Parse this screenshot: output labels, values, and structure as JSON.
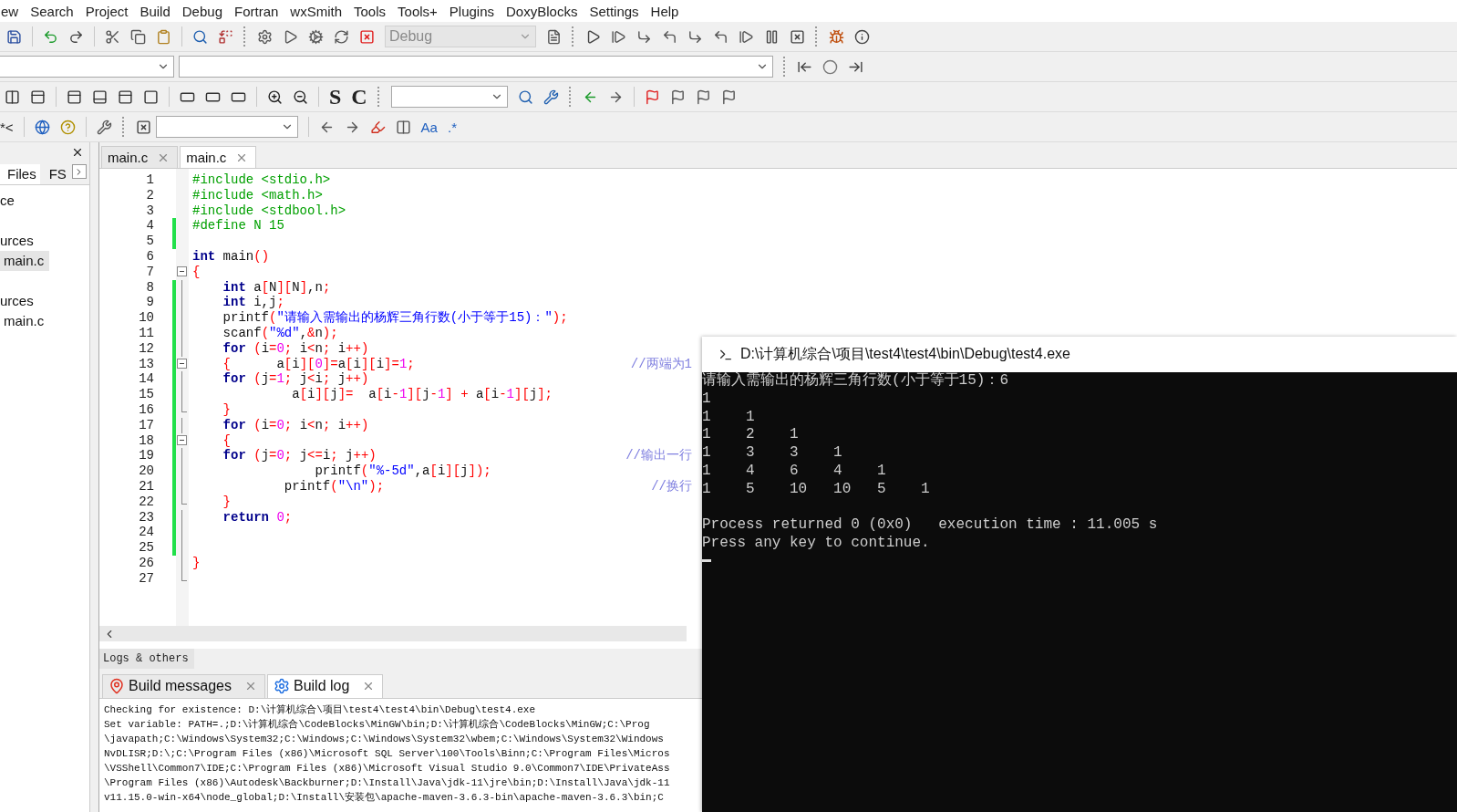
{
  "menu": [
    {
      "label": "ew"
    },
    {
      "label": "Search"
    },
    {
      "label": "Project"
    },
    {
      "label": "Build"
    },
    {
      "label": "Debug"
    },
    {
      "label": "Fortran"
    },
    {
      "label": "wxSmith"
    },
    {
      "label": "Tools"
    },
    {
      "label": "Tools+"
    },
    {
      "label": "Plugins"
    },
    {
      "label": "DoxyBlocks"
    },
    {
      "label": "Settings"
    },
    {
      "label": "Help"
    }
  ],
  "toolbars": {
    "build_target": {
      "value": "Debug",
      "disabled": true
    },
    "labels": [
      "S",
      "C",
      "*<",
      "Aa",
      ".*"
    ]
  },
  "management": {
    "tabs": [
      {
        "label": "Files",
        "selected": true
      },
      {
        "label": "FS",
        "selected": false
      }
    ],
    "tree": [
      {
        "label": "ce",
        "children": [
          {
            "label": "urces",
            "children": [
              {
                "label": "main.c",
                "selected": true
              }
            ]
          },
          {
            "label": "urces",
            "children": [
              {
                "label": "main.c",
                "selected": false
              }
            ]
          }
        ]
      }
    ]
  },
  "editor": {
    "tabs": [
      {
        "label": "main.c",
        "selected": false
      },
      {
        "label": "main.c",
        "selected": true
      }
    ],
    "lines": [
      {
        "number": "1",
        "changed": false,
        "fold_toggle": false,
        "fold_end": false,
        "tokens": [
          {
            "kind": "preprocessor",
            "text": "#include <stdio.h>"
          }
        ]
      },
      {
        "number": "2",
        "changed": false,
        "fold_toggle": false,
        "fold_end": false,
        "tokens": [
          {
            "kind": "preprocessor",
            "text": "#include <math.h>"
          }
        ]
      },
      {
        "number": "3",
        "changed": false,
        "fold_toggle": false,
        "fold_end": false,
        "tokens": [
          {
            "kind": "preprocessor",
            "text": "#include <stdbool.h>"
          }
        ]
      },
      {
        "number": "4",
        "changed": true,
        "fold_toggle": false,
        "fold_end": false,
        "tokens": [
          {
            "kind": "preprocessor",
            "text": "#define N 15"
          }
        ]
      },
      {
        "number": "5",
        "changed": true,
        "fold_toggle": false,
        "fold_end": false
      },
      {
        "number": "6",
        "changed": false,
        "fold_toggle": false,
        "fold_end": false,
        "tokens": [
          {
            "kind": "keyword",
            "text": "int"
          },
          {
            "kind": "plain",
            "text": " main"
          },
          {
            "kind": "operator",
            "text": "()"
          }
        ]
      },
      {
        "number": "7",
        "changed": false,
        "fold_toggle": true,
        "fold_end": false,
        "tokens": [
          {
            "kind": "operator",
            "text": "{"
          }
        ]
      },
      {
        "number": "8",
        "changed": true,
        "fold_toggle": false,
        "fold_end": false,
        "tokens": [
          {
            "kind": "keyword",
            "text": "    int"
          },
          {
            "kind": "plain",
            "text": " a"
          },
          {
            "kind": "operator",
            "text": "["
          },
          {
            "kind": "plain",
            "text": "N"
          },
          {
            "kind": "operator",
            "text": "]["
          },
          {
            "kind": "plain",
            "text": "N"
          },
          {
            "kind": "operator",
            "text": "]"
          },
          {
            "kind": "plain",
            "text": ",n"
          },
          {
            "kind": "operator",
            "text": ";"
          }
        ]
      },
      {
        "number": "9",
        "changed": true,
        "fold_toggle": false,
        "fold_end": false,
        "tokens": [
          {
            "kind": "keyword",
            "text": "    int"
          },
          {
            "kind": "plain",
            "text": " i,j"
          },
          {
            "kind": "operator",
            "text": ";"
          }
        ]
      },
      {
        "number": "10",
        "changed": true,
        "fold_toggle": false,
        "fold_end": false,
        "tokens": [
          {
            "kind": "plain",
            "text": "    printf"
          },
          {
            "kind": "operator",
            "text": "("
          },
          {
            "kind": "string",
            "text": "\"请输入需输出的杨辉三角行数(小于等于15)：\""
          },
          {
            "kind": "operator",
            "text": ");"
          }
        ]
      },
      {
        "number": "11",
        "changed": true,
        "fold_toggle": false,
        "fold_end": false,
        "tokens": [
          {
            "kind": "plain",
            "text": "    scanf"
          },
          {
            "kind": "operator",
            "text": "("
          },
          {
            "kind": "string",
            "text": "\"%d\""
          },
          {
            "kind": "plain",
            "text": ","
          },
          {
            "kind": "operator",
            "text": "&"
          },
          {
            "kind": "plain",
            "text": "n"
          },
          {
            "kind": "operator",
            "text": ");"
          }
        ]
      },
      {
        "number": "12",
        "changed": true,
        "fold_toggle": false,
        "fold_end": false,
        "tokens": [
          {
            "kind": "keyword",
            "text": "    for"
          },
          {
            "kind": "operator",
            "text": " ("
          },
          {
            "kind": "plain",
            "text": "i"
          },
          {
            "kind": "operator",
            "text": "="
          },
          {
            "kind": "number",
            "text": "0"
          },
          {
            "kind": "operator",
            "text": ";"
          },
          {
            "kind": "plain",
            "text": " i"
          },
          {
            "kind": "operator",
            "text": "<"
          },
          {
            "kind": "plain",
            "text": "n"
          },
          {
            "kind": "operator",
            "text": ";"
          },
          {
            "kind": "plain",
            "text": " i"
          },
          {
            "kind": "operator",
            "text": "++)"
          }
        ]
      },
      {
        "number": "13",
        "changed": true,
        "fold_toggle": true,
        "fold_end": false,
        "comment": "//两端为1",
        "tokens": [
          {
            "kind": "operator",
            "text": "    {"
          },
          {
            "kind": "plain",
            "text": "      a"
          },
          {
            "kind": "operator",
            "text": "["
          },
          {
            "kind": "plain",
            "text": "i"
          },
          {
            "kind": "operator",
            "text": "]["
          },
          {
            "kind": "number",
            "text": "0"
          },
          {
            "kind": "operator",
            "text": "]="
          },
          {
            "kind": "plain",
            "text": "a"
          },
          {
            "kind": "operator",
            "text": "["
          },
          {
            "kind": "plain",
            "text": "i"
          },
          {
            "kind": "operator",
            "text": "]["
          },
          {
            "kind": "plain",
            "text": "i"
          },
          {
            "kind": "operator",
            "text": "]="
          },
          {
            "kind": "number",
            "text": "1"
          },
          {
            "kind": "operator",
            "text": ";"
          }
        ]
      },
      {
        "number": "14",
        "changed": true,
        "fold_toggle": false,
        "fold_end": false,
        "tokens": [
          {
            "kind": "keyword",
            "text": "    for"
          },
          {
            "kind": "operator",
            "text": " ("
          },
          {
            "kind": "plain",
            "text": "j"
          },
          {
            "kind": "operator",
            "text": "="
          },
          {
            "kind": "number",
            "text": "1"
          },
          {
            "kind": "operator",
            "text": ";"
          },
          {
            "kind": "plain",
            "text": " j"
          },
          {
            "kind": "operator",
            "text": "<"
          },
          {
            "kind": "plain",
            "text": "i"
          },
          {
            "kind": "operator",
            "text": ";"
          },
          {
            "kind": "plain",
            "text": " j"
          },
          {
            "kind": "operator",
            "text": "++)"
          }
        ]
      },
      {
        "number": "15",
        "changed": true,
        "fold_toggle": false,
        "fold_end": false,
        "tokens": [
          {
            "kind": "plain",
            "text": "             a"
          },
          {
            "kind": "operator",
            "text": "["
          },
          {
            "kind": "plain",
            "text": "i"
          },
          {
            "kind": "operator",
            "text": "]["
          },
          {
            "kind": "plain",
            "text": "j"
          },
          {
            "kind": "operator",
            "text": "]="
          },
          {
            "kind": "plain",
            "text": "  a"
          },
          {
            "kind": "operator",
            "text": "["
          },
          {
            "kind": "plain",
            "text": "i"
          },
          {
            "kind": "operator",
            "text": "-"
          },
          {
            "kind": "number",
            "text": "1"
          },
          {
            "kind": "operator",
            "text": "]["
          },
          {
            "kind": "plain",
            "text": "j"
          },
          {
            "kind": "operator",
            "text": "-"
          },
          {
            "kind": "number",
            "text": "1"
          },
          {
            "kind": "operator",
            "text": "] + "
          },
          {
            "kind": "plain",
            "text": "a"
          },
          {
            "kind": "operator",
            "text": "["
          },
          {
            "kind": "plain",
            "text": "i"
          },
          {
            "kind": "operator",
            "text": "-"
          },
          {
            "kind": "number",
            "text": "1"
          },
          {
            "kind": "operator",
            "text": "]["
          },
          {
            "kind": "plain",
            "text": "j"
          },
          {
            "kind": "operator",
            "text": "];"
          }
        ]
      },
      {
        "number": "16",
        "changed": true,
        "fold_toggle": false,
        "fold_end": true,
        "tokens": [
          {
            "kind": "operator",
            "text": "    }"
          }
        ]
      },
      {
        "number": "17",
        "changed": true,
        "fold_toggle": false,
        "fold_end": false,
        "tokens": [
          {
            "kind": "keyword",
            "text": "    for"
          },
          {
            "kind": "operator",
            "text": " ("
          },
          {
            "kind": "plain",
            "text": "i"
          },
          {
            "kind": "operator",
            "text": "="
          },
          {
            "kind": "number",
            "text": "0"
          },
          {
            "kind": "operator",
            "text": ";"
          },
          {
            "kind": "plain",
            "text": " i"
          },
          {
            "kind": "operator",
            "text": "<"
          },
          {
            "kind": "plain",
            "text": "n"
          },
          {
            "kind": "operator",
            "text": ";"
          },
          {
            "kind": "plain",
            "text": " i"
          },
          {
            "kind": "operator",
            "text": "++)"
          }
        ]
      },
      {
        "number": "18",
        "changed": true,
        "fold_toggle": true,
        "fold_end": false,
        "tokens": [
          {
            "kind": "operator",
            "text": "    {"
          }
        ]
      },
      {
        "number": "19",
        "changed": true,
        "fold_toggle": false,
        "fold_end": false,
        "comment": "//输出一行",
        "tokens": [
          {
            "kind": "keyword",
            "text": "    for"
          },
          {
            "kind": "operator",
            "text": " ("
          },
          {
            "kind": "plain",
            "text": "j"
          },
          {
            "kind": "operator",
            "text": "="
          },
          {
            "kind": "number",
            "text": "0"
          },
          {
            "kind": "operator",
            "text": ";"
          },
          {
            "kind": "plain",
            "text": " j"
          },
          {
            "kind": "operator",
            "text": "<="
          },
          {
            "kind": "plain",
            "text": "i"
          },
          {
            "kind": "operator",
            "text": ";"
          },
          {
            "kind": "plain",
            "text": " j"
          },
          {
            "kind": "operator",
            "text": "++)"
          }
        ]
      },
      {
        "number": "20",
        "changed": true,
        "fold_toggle": false,
        "fold_end": false,
        "tokens": [
          {
            "kind": "plain",
            "text": "                printf"
          },
          {
            "kind": "operator",
            "text": "("
          },
          {
            "kind": "string",
            "text": "\"%-5d\""
          },
          {
            "kind": "plain",
            "text": ",a"
          },
          {
            "kind": "operator",
            "text": "["
          },
          {
            "kind": "plain",
            "text": "i"
          },
          {
            "kind": "operator",
            "text": "]["
          },
          {
            "kind": "plain",
            "text": "j"
          },
          {
            "kind": "operator",
            "text": "]);"
          }
        ]
      },
      {
        "number": "21",
        "changed": true,
        "fold_toggle": false,
        "fold_end": false,
        "comment": "//换行",
        "tokens": [
          {
            "kind": "plain",
            "text": "            printf"
          },
          {
            "kind": "operator",
            "text": "("
          },
          {
            "kind": "string",
            "text": "\"\\n\""
          },
          {
            "kind": "operator",
            "text": ");"
          }
        ]
      },
      {
        "number": "22",
        "changed": true,
        "fold_toggle": false,
        "fold_end": true,
        "tokens": [
          {
            "kind": "operator",
            "text": "    }"
          }
        ]
      },
      {
        "number": "23",
        "changed": true,
        "fold_toggle": false,
        "fold_end": false,
        "tokens": [
          {
            "kind": "keyword",
            "text": "    return"
          },
          {
            "kind": "number",
            "text": " 0"
          },
          {
            "kind": "operator",
            "text": ";"
          }
        ]
      },
      {
        "number": "24",
        "changed": true,
        "fold_toggle": false,
        "fold_end": false
      },
      {
        "number": "25",
        "changed": true,
        "fold_toggle": false,
        "fold_end": false
      },
      {
        "number": "26",
        "changed": false,
        "fold_toggle": false,
        "fold_end": false,
        "tokens": [
          {
            "kind": "operator",
            "text": "}"
          }
        ]
      },
      {
        "number": "27",
        "changed": false,
        "fold_toggle": false,
        "fold_end": true
      }
    ]
  },
  "logs": {
    "title": "Logs & others",
    "tabs": [
      {
        "label": "Build messages",
        "kind": "messages",
        "selected": false
      },
      {
        "label": "Build log",
        "kind": "log",
        "selected": true
      }
    ],
    "lines": [
      "Checking for existence: D:\\计算机综合\\项目\\test4\\test4\\bin\\Debug\\test4.exe",
      "Set variable: PATH=.;D:\\计算机综合\\CodeBlocks\\MinGW\\bin;D:\\计算机综合\\CodeBlocks\\MinGW;C:\\Prog",
      "\\javapath;C:\\Windows\\System32;C:\\Windows;C:\\Windows\\System32\\wbem;C:\\Windows\\System32\\Windows",
      "NvDLISR;D:\\;C:\\Program Files (x86)\\Microsoft SQL Server\\100\\Tools\\Binn;C:\\Program Files\\Micros",
      "\\VSShell\\Common7\\IDE;C:\\Program Files (x86)\\Microsoft Visual Studio 9.0\\Common7\\IDE\\PrivateAss",
      "\\Program Files (x86)\\Autodesk\\Backburner;D:\\Install\\Java\\jdk-11\\jre\\bin;D:\\Install\\Java\\jdk-11",
      "v11.15.0-win-x64\\node_global;D:\\Install\\安装包\\apache-maven-3.6.3-bin\\apache-maven-3.6.3\\bin;C"
    ]
  },
  "console": {
    "title": "D:\\计算机综合\\项目\\test4\\test4\\bin\\Debug\\test4.exe",
    "output": [
      "请输入需输出的杨辉三角行数(小于等于15)：6",
      "1",
      "1    1",
      "1    2    1",
      "1    3    3    1",
      "1    4    6    4    1",
      "1    5    10   10   5    1"
    ],
    "status": [
      "Process returned 0 (0x0)   execution time : 11.005 s",
      "Press any key to continue."
    ],
    "cursor": true
  }
}
